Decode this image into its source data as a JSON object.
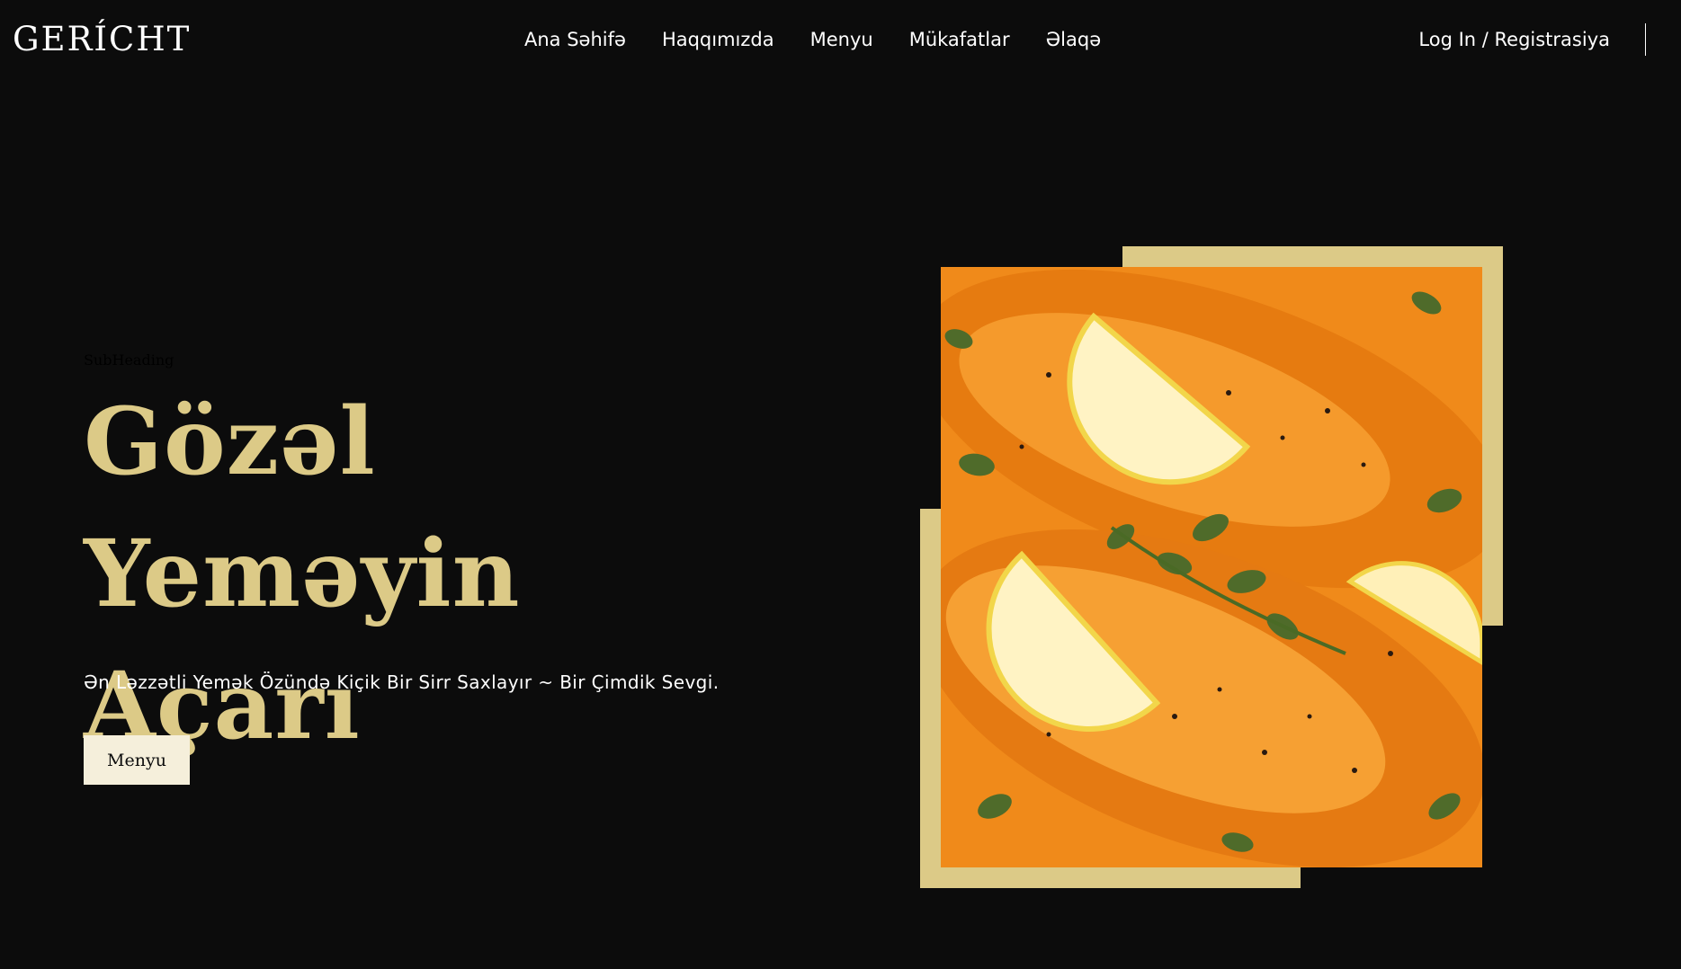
{
  "brand": {
    "logo": "GERÍCHT"
  },
  "nav": {
    "items": [
      "Ana Səhifə",
      "Haqqımızda",
      "Menyu",
      "Mükafatlar",
      "Əlaqə"
    ],
    "login": "Log In / Registrasiya"
  },
  "hero": {
    "subheading": "SubHeading",
    "title_line1": "Gözəl Yeməyin",
    "title_line2": "Açarı",
    "tagline": "Ən Ləzzətli Yemək Özündə Kiçik Bir Sirr Saxlayır ~ Bir Çimdik Sevgi.",
    "button_label": "Menyu"
  },
  "colors": {
    "background": "#0c0c0c",
    "gold": "#dcca87",
    "cream": "#f5efdb"
  }
}
